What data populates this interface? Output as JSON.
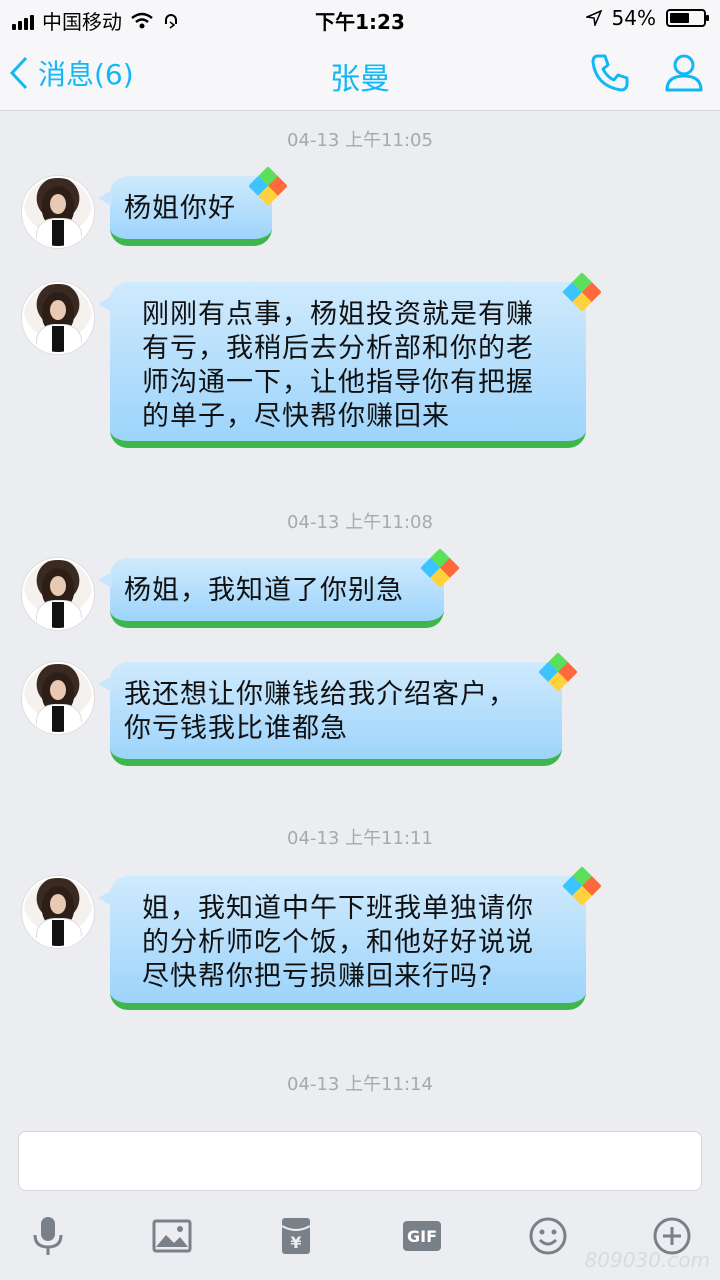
{
  "status_bar": {
    "carrier": "中国移动",
    "time": "下午1:23",
    "battery": "54%",
    "battery_level": 0.54
  },
  "nav": {
    "back_label": "消息(6)",
    "title": "张曼"
  },
  "messages": [
    {
      "timestamp": "04-13 上午11:05"
    },
    {
      "text": "杨姐你好"
    },
    {
      "lines": [
        "刚刚有点事，杨姐投资就是有赚",
        "有亏，我稍后去分析部和你的老",
        "师沟通一下，让他指导你有把握",
        "的单子，尽快帮你赚回来"
      ]
    },
    {
      "timestamp": "04-13 上午11:08"
    },
    {
      "text": "杨姐，我知道了你别急"
    },
    {
      "lines": [
        "我还想让你赚钱给我介绍客户，",
        "你亏钱我比谁都急"
      ]
    },
    {
      "timestamp": "04-13 上午11:11"
    },
    {
      "lines": [
        "姐，我知道中午下班我单独请你",
        "的分析师吃个饭，和他好好说说",
        "尽快帮你把亏损赚回来行吗?"
      ]
    },
    {
      "timestamp": "04-13 上午11:14"
    }
  ],
  "toolbar": {
    "gif_label": "GIF"
  },
  "watermark": "809030.com",
  "colors": {
    "accent": "#12b7f5",
    "bubble_top": "#cfeafd",
    "bubble_bottom": "#9dd4fb",
    "grass": "#3fb64b"
  }
}
